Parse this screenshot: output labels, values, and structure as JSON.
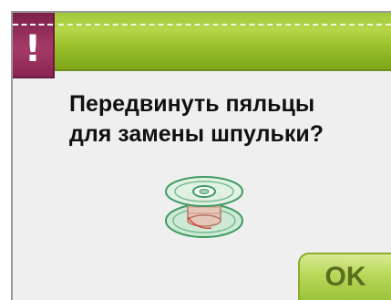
{
  "dialog": {
    "badge_icon": "exclamation-icon",
    "badge_symbol": "!",
    "message_line1": "Передвинуть пяльцы",
    "message_line2": "для замены шпульки?",
    "illustration": "bobbin-icon",
    "ok_label": "OK"
  },
  "colors": {
    "header_green": "#97bd28",
    "badge_magenta": "#a53a67",
    "button_green": "#b8d85a",
    "background": "#efefef"
  }
}
